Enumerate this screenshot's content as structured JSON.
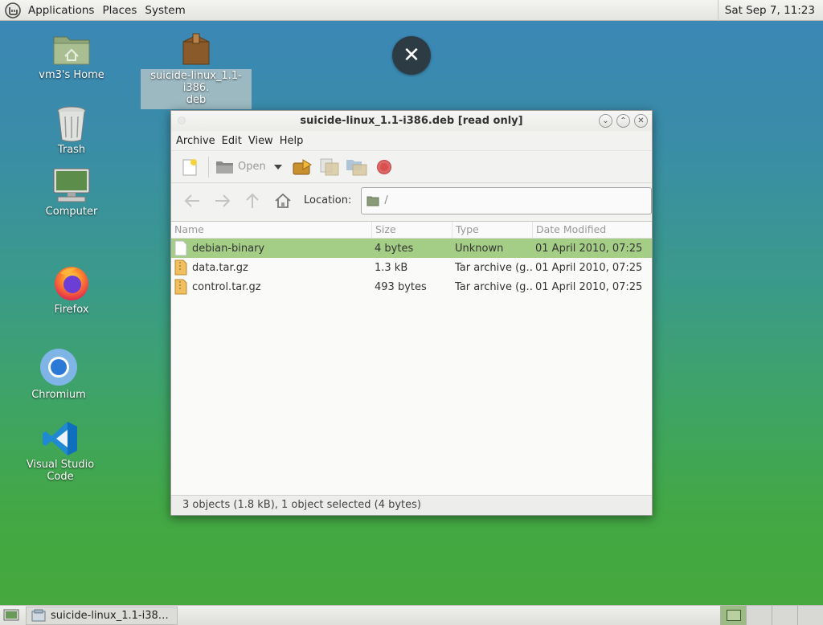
{
  "top_panel": {
    "menus": [
      "Applications",
      "Places",
      "System"
    ],
    "clock": "Sat Sep  7, 11:23"
  },
  "desktop": {
    "icons": [
      {
        "label": "vm3's Home",
        "icon": "home-folder-icon"
      },
      {
        "label": "Trash",
        "icon": "trash-icon"
      },
      {
        "label": "Computer",
        "icon": "computer-icon"
      },
      {
        "label": "Firefox",
        "icon": "firefox-icon"
      },
      {
        "label": "Chromium",
        "icon": "chromium-icon"
      },
      {
        "label": "Visual Studio Code",
        "icon": "vscode-icon"
      }
    ],
    "file_icon": {
      "line1": "suicide-linux_1.1-i386.",
      "line2": "deb",
      "icon": "package-icon"
    },
    "close_glyph": "✕"
  },
  "window": {
    "title": "suicide-linux_1.1-i386.deb [read only]",
    "menu": [
      "Archive",
      "Edit",
      "View",
      "Help"
    ],
    "toolbar": {
      "open_label": "Open"
    },
    "location": {
      "label": "Location:",
      "value": "/"
    },
    "columns": [
      "Name",
      "Size",
      "Type",
      "Date Modified"
    ],
    "files": [
      {
        "name": "debian-binary",
        "size": "4 bytes",
        "type": "Unknown",
        "date": "01 April 2010, 07:25",
        "selected": true
      },
      {
        "name": "data.tar.gz",
        "size": "1.3 kB",
        "type": "Tar archive (g…",
        "date": "01 April 2010, 07:25",
        "selected": false
      },
      {
        "name": "control.tar.gz",
        "size": "493 bytes",
        "type": "Tar archive (g…",
        "date": "01 April 2010, 07:25",
        "selected": false
      }
    ],
    "status": "3 objects (1.8 kB), 1 object selected (4 bytes)"
  },
  "bottom_panel": {
    "task_label": "suicide-linux_1.1-i38…"
  },
  "colors": {
    "selection": "#a4cd86",
    "accent": "#6aa84f"
  }
}
